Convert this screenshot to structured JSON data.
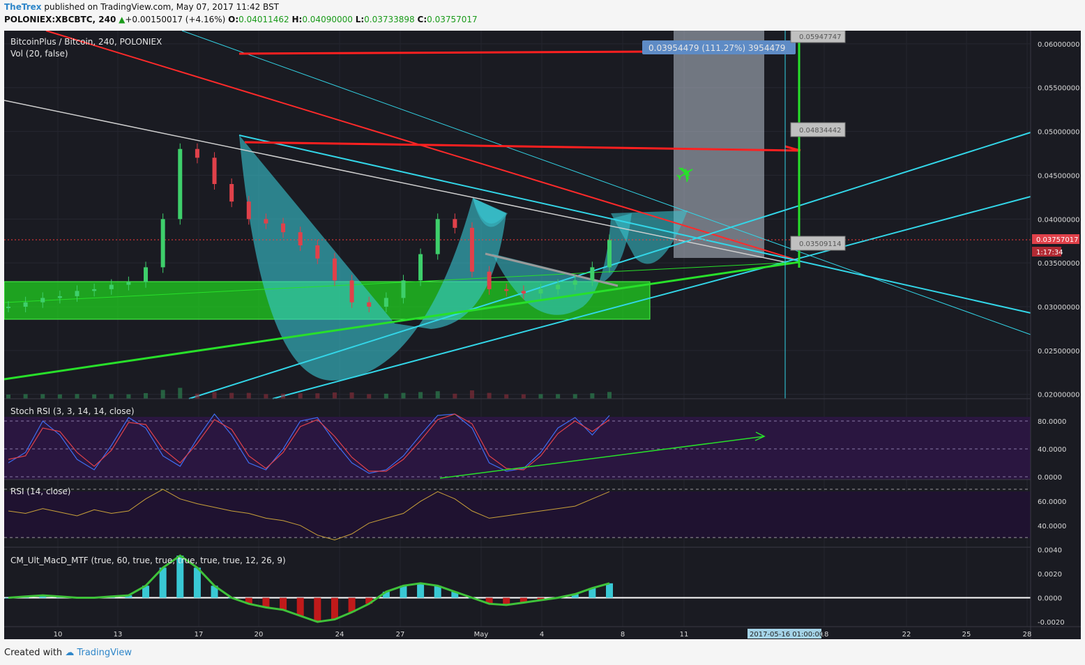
{
  "header": {
    "publisher": "TheTrex",
    "published_text": "published on TradingView.com, May 07, 2017 11:42 BST",
    "symbol_line": "POLONIEX:XBCBTC, 240",
    "change": "+0.00150017 (+4.16%)",
    "o_label": "O:",
    "o_value": "0.04011462",
    "h_label": "H:",
    "h_value": "0.04090000",
    "l_label": "L:",
    "l_value": "0.03733898",
    "c_label": "C:",
    "c_value": "0.03757017"
  },
  "footer": {
    "created_with": "Created with",
    "brand": "TradingView"
  },
  "colors": {
    "background": "#1a1b22",
    "bull": "#3ecf6b",
    "bear": "#e0414a",
    "cyan": "#33d6e8",
    "green": "#28e02a",
    "red": "#ff2020",
    "purple_band": "#2a1640"
  },
  "chart_data": [
    {
      "type": "line",
      "title": "BitcoinPlus / Bitcoin, 240, POLONIEX",
      "subtitle": "Vol (20, false)",
      "x_labels": [
        "10",
        "13",
        "17",
        "20",
        "24",
        "27",
        "May",
        "4",
        "8",
        "11",
        "18",
        "22",
        "25",
        "28"
      ],
      "y_ticks": [
        "0.06000000",
        "0.05500000",
        "0.05000000",
        "0.04500000",
        "0.04000000",
        "0.03500000",
        "0.03000000",
        "0.02500000",
        "0.02000000"
      ],
      "ylim": [
        0.0195,
        0.0615
      ],
      "last_price": "0.03757017",
      "countdown": "1:17:34",
      "cursor_date": "2017-05-16 01:00:00",
      "series": [
        {
          "values": [
            0.03,
            0.0305,
            0.031,
            0.0312,
            0.0318,
            0.032,
            0.0325,
            0.0328,
            0.0345,
            0.04,
            0.048,
            0.047,
            0.044,
            0.042,
            0.04,
            0.0395,
            0.0385,
            0.037,
            0.0355,
            0.033,
            0.0305,
            0.03,
            0.031,
            0.033,
            0.036,
            0.04,
            0.039,
            0.034,
            0.032,
            0.0318,
            0.0315,
            0.032,
            0.0325,
            0.033,
            0.0345,
            0.0376
          ]
        }
      ],
      "annotations": {
        "measure_label": "0.03954479 (111.27%) 3954479",
        "target_1": "0.05947747",
        "target_2": "0.04834442",
        "target_3": "0.03509114"
      }
    },
    {
      "type": "line",
      "title": "Stoch RSI (3, 3, 14, 14, close)",
      "y_ticks": [
        "80.0000",
        "40.0000",
        "0.0000"
      ],
      "ylim": [
        0,
        100
      ],
      "series": [
        {
          "values": [
            20,
            35,
            80,
            60,
            25,
            10,
            45,
            85,
            70,
            30,
            15,
            55,
            90,
            60,
            20,
            10,
            40,
            80,
            85,
            50,
            20,
            5,
            10,
            30,
            60,
            88,
            90,
            70,
            20,
            8,
            12,
            35,
            70,
            85,
            60,
            88
          ]
        },
        {
          "values": [
            25,
            30,
            70,
            65,
            35,
            15,
            38,
            78,
            75,
            40,
            20,
            48,
            82,
            68,
            30,
            12,
            35,
            72,
            82,
            58,
            28,
            8,
            8,
            25,
            52,
            82,
            90,
            76,
            30,
            12,
            10,
            30,
            62,
            80,
            65,
            82
          ]
        }
      ]
    },
    {
      "type": "line",
      "title": "RSI (14, close)",
      "y_ticks": [
        "60.0000",
        "40.0000"
      ],
      "ylim": [
        22,
        78
      ],
      "series": [
        {
          "values": [
            52,
            50,
            54,
            51,
            48,
            53,
            50,
            52,
            62,
            70,
            62,
            58,
            55,
            52,
            50,
            46,
            44,
            40,
            32,
            28,
            33,
            42,
            46,
            50,
            60,
            68,
            62,
            52,
            46,
            48,
            50,
            52,
            54,
            56,
            62,
            68
          ]
        }
      ]
    },
    {
      "type": "bar",
      "title": "CM_Ult_MacD_MTF (true, 60, true, true, true, true, true, 12, 26, 9)",
      "y_ticks": [
        "0.0040",
        "0.0020",
        "0.0000",
        "-0.0020"
      ],
      "ylim": [
        -0.0024,
        0.0042
      ],
      "series": [
        {
          "name": "",
          "values": [
            0.0,
            0.0001,
            0.0002,
            0.0001,
            0.0,
            0.0,
            0.0001,
            0.0002,
            0.001,
            0.0025,
            0.0035,
            0.0025,
            0.001,
            0.0,
            -0.0005,
            -0.0008,
            -0.001,
            -0.0015,
            -0.002,
            -0.0018,
            -0.0012,
            -0.0005,
            0.0005,
            0.001,
            0.0012,
            0.001,
            0.0005,
            0.0,
            -0.0005,
            -0.0006,
            -0.0004,
            -0.0002,
            0.0,
            0.0003,
            0.0008,
            0.0012
          ]
        }
      ]
    }
  ]
}
